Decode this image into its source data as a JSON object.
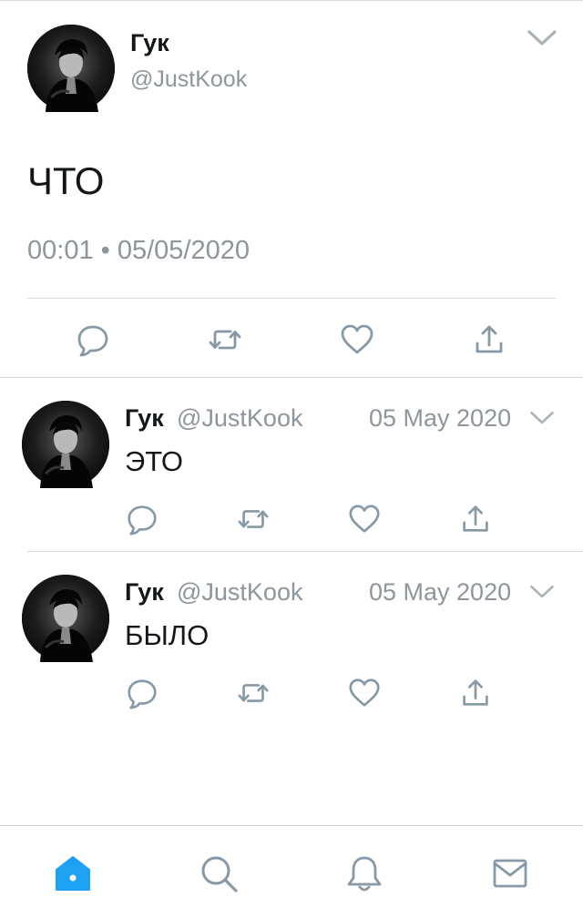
{
  "main_tweet": {
    "name": "Гук",
    "handle": "@JustKook",
    "text": "ЧТО",
    "meta": "00:01 • 05/05/2020"
  },
  "replies": [
    {
      "name": "Гук",
      "handle": "@JustKook",
      "date": "05 May 2020",
      "text": "ЭТО"
    },
    {
      "name": "Гук",
      "handle": "@JustKook",
      "date": "05 May 2020",
      "text": "БЫЛО"
    }
  ],
  "colors": {
    "text": "#14171a",
    "secondary": "#8e959c",
    "icon": "#8899a6",
    "accent": "#1da1f2",
    "divider": "#d6dadf"
  },
  "icons": {
    "actions": [
      "reply-icon",
      "retweet-icon",
      "like-icon",
      "share-icon"
    ],
    "tabs": [
      "home-icon",
      "search-icon",
      "notifications-icon",
      "messages-icon"
    ]
  }
}
